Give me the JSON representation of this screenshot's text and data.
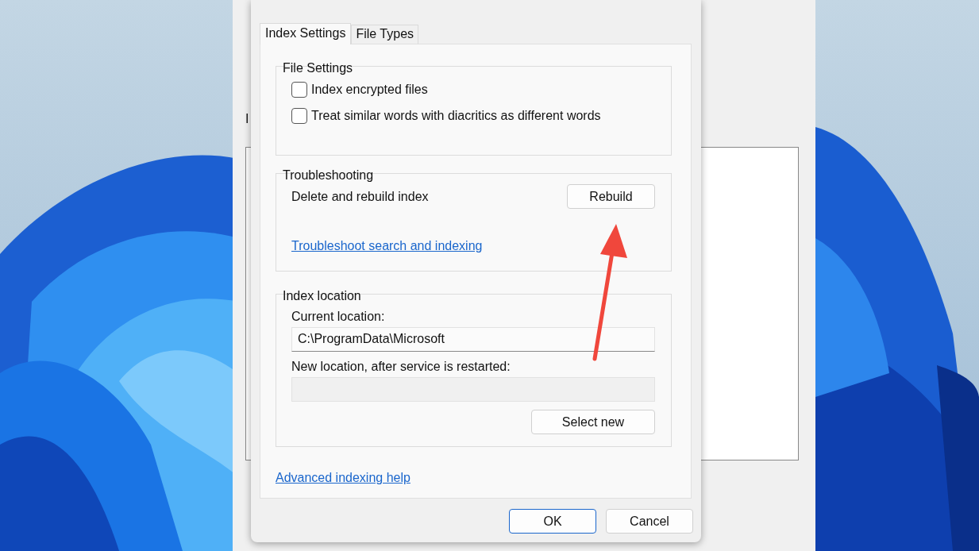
{
  "background_window": {
    "label": "I"
  },
  "dialog": {
    "tabs": [
      {
        "label": "Index Settings",
        "selected": true
      },
      {
        "label": "File Types",
        "selected": false
      }
    ],
    "file_settings": {
      "title": "File Settings",
      "options": [
        {
          "label": "Index encrypted files",
          "checked": false
        },
        {
          "label": "Treat similar words with diacritics as different words",
          "checked": false
        }
      ]
    },
    "troubleshooting": {
      "title": "Troubleshooting",
      "rebuild_label": "Delete and rebuild index",
      "rebuild_button": "Rebuild",
      "link": "Troubleshoot search and indexing"
    },
    "index_location": {
      "title": "Index location",
      "current_label": "Current location:",
      "current_value": "C:\\ProgramData\\Microsoft",
      "new_label": "New location, after service is restarted:",
      "select_button": "Select new"
    },
    "help_link": "Advanced indexing help",
    "buttons": [
      {
        "label": "OK",
        "default": true
      },
      {
        "label": "Cancel",
        "default": false
      }
    ]
  }
}
